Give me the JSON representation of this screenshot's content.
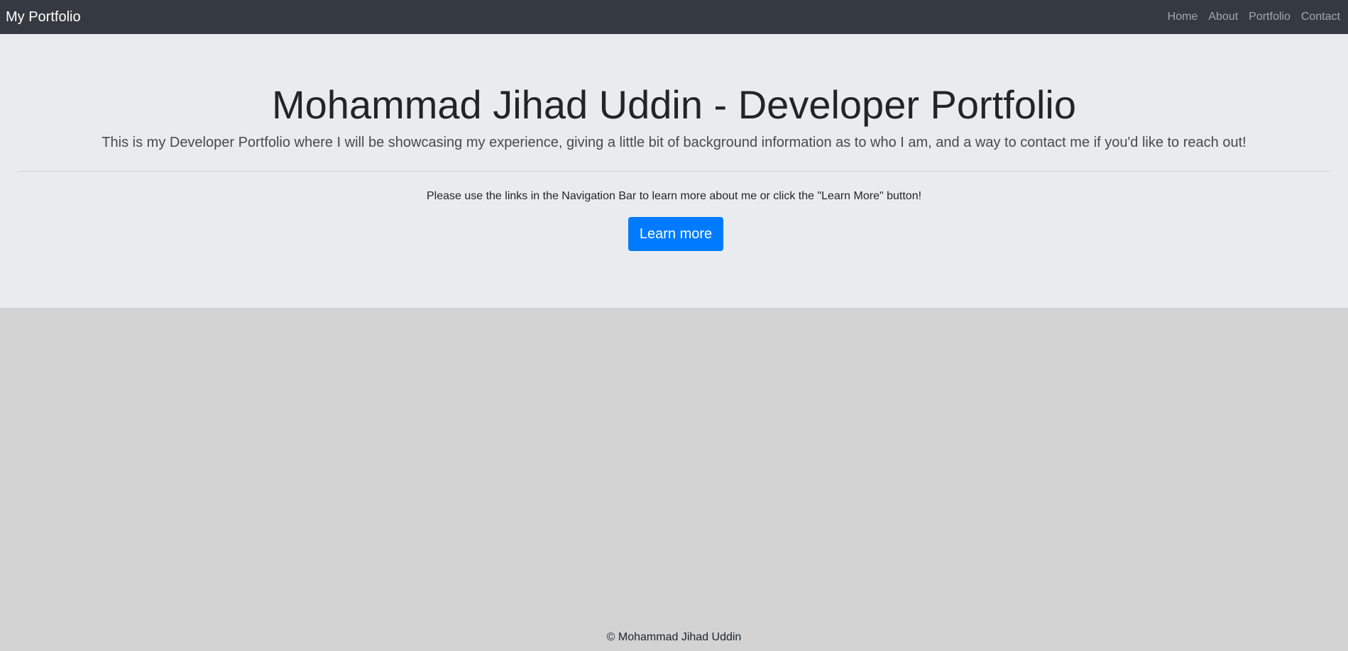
{
  "navbar": {
    "brand": "My Portfolio",
    "links": [
      {
        "label": "Home"
      },
      {
        "label": "About"
      },
      {
        "label": "Portfolio"
      },
      {
        "label": "Contact"
      }
    ]
  },
  "hero": {
    "title": "Mohammad Jihad Uddin - Developer Portfolio",
    "lead": "This is my Developer Portfolio where I will be showcasing my experience, giving a little bit of background information as to who I am, and a way to contact me if you'd like to reach out!",
    "info": "Please use the links in the Navigation Bar to learn more about me or click the \"Learn More\" button!",
    "button_label": "Learn more"
  },
  "footer": {
    "text": "© Mohammad Jihad Uddin"
  },
  "colors": {
    "navbar": "#343a40",
    "hero_background": "#e9ecef",
    "page_background": "#d3d3d3",
    "button": "#007bff"
  }
}
